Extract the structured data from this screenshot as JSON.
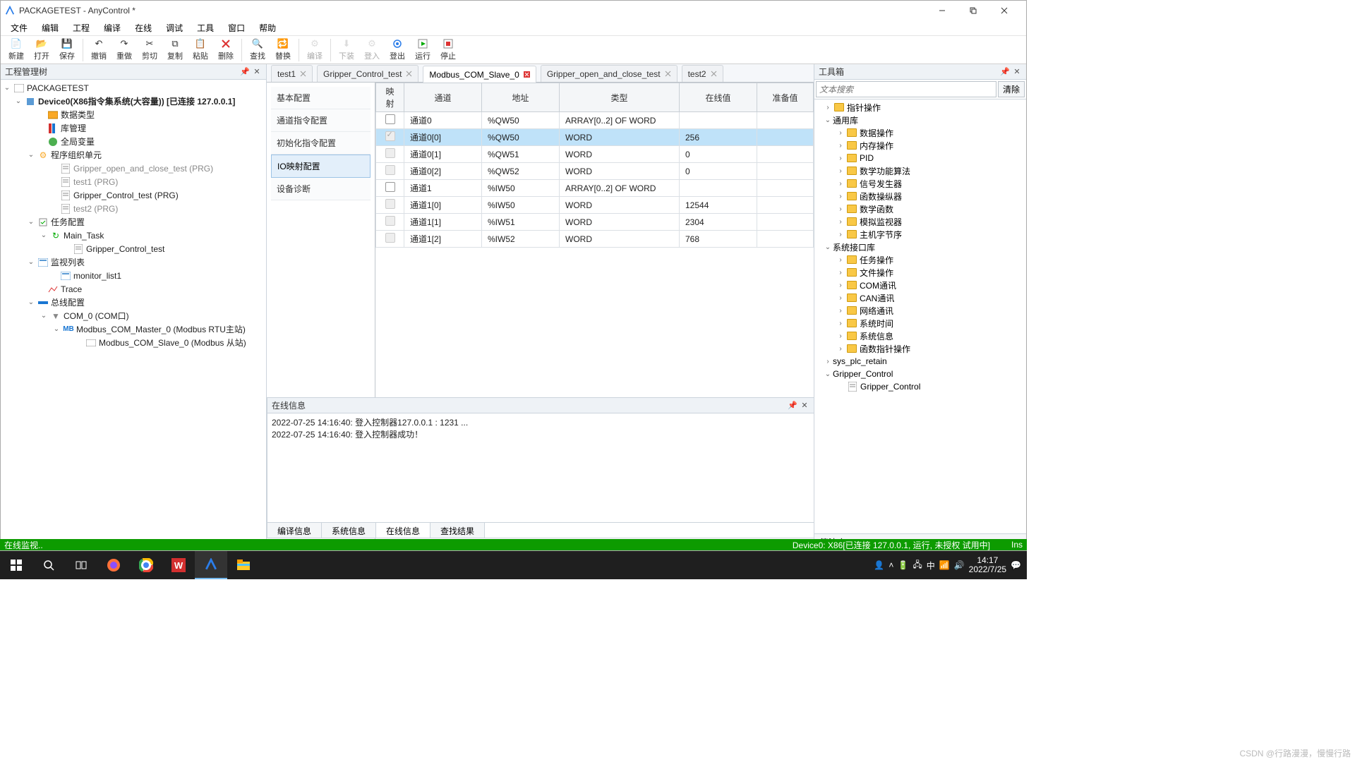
{
  "window": {
    "title": "PACKAGETEST - AnyControl *"
  },
  "menubar": [
    "文件",
    "编辑",
    "工程",
    "编译",
    "在线",
    "调试",
    "工具",
    "窗口",
    "帮助"
  ],
  "toolbar": [
    {
      "label": "新建",
      "icon": "new"
    },
    {
      "label": "打开",
      "icon": "open"
    },
    {
      "label": "保存",
      "icon": "save"
    },
    {
      "sep": true
    },
    {
      "label": "撤销",
      "icon": "undo"
    },
    {
      "label": "重做",
      "icon": "redo"
    },
    {
      "label": "剪切",
      "icon": "cut"
    },
    {
      "label": "复制",
      "icon": "copy"
    },
    {
      "label": "粘贴",
      "icon": "paste"
    },
    {
      "label": "删除",
      "icon": "delete"
    },
    {
      "sep": true
    },
    {
      "label": "查找",
      "icon": "find"
    },
    {
      "label": "替换",
      "icon": "replace"
    },
    {
      "sep": true
    },
    {
      "label": "编译",
      "icon": "compile",
      "dim": true
    },
    {
      "sep": true
    },
    {
      "label": "下装",
      "icon": "download",
      "dim": true
    },
    {
      "label": "登入",
      "icon": "login",
      "dim": true
    },
    {
      "label": "登出",
      "icon": "logout"
    },
    {
      "label": "运行",
      "icon": "run"
    },
    {
      "label": "停止",
      "icon": "stop"
    }
  ],
  "panel_titles": {
    "tree": "工程管理树",
    "toolbox": "工具箱",
    "online": "在线信息"
  },
  "tree": {
    "root": "PACKAGETEST",
    "device": "Device0(X86指令集系统(大容量)) [已连接 127.0.0.1]",
    "data_types": "数据类型",
    "lib": "库管理",
    "global": "全局变量",
    "pou": "程序组织单元",
    "pou_items": [
      "Gripper_open_and_close_test (PRG)",
      "test1 (PRG)",
      "Gripper_Control_test (PRG)",
      "test2 (PRG)"
    ],
    "task_cfg": "任务配置",
    "main_task": "Main_Task",
    "task_item": "Gripper_Control_test",
    "watch": "监视列表",
    "watch_item": "monitor_list1",
    "trace": "Trace",
    "bus": "总线配置",
    "com": "COM_0 (COM口)",
    "modbus_master": "Modbus_COM_Master_0 (Modbus RTU主站)",
    "modbus_slave": "Modbus_COM_Slave_0 (Modbus 从站)"
  },
  "tabs": [
    {
      "label": "test1",
      "close": "gray"
    },
    {
      "label": "Gripper_Control_test",
      "close": "gray"
    },
    {
      "label": "Modbus_COM_Slave_0",
      "close": "red",
      "active": true
    },
    {
      "label": "Gripper_open_and_close_test",
      "close": "gray"
    },
    {
      "label": "test2",
      "close": "gray"
    }
  ],
  "sidenav": [
    "基本配置",
    "通道指令配置",
    "初始化指令配置",
    "IO映射配置",
    "设备诊断"
  ],
  "sidenav_active": 3,
  "table": {
    "headers": [
      "映射",
      "通道",
      "地址",
      "类型",
      "在线值",
      "准备值"
    ],
    "rows": [
      {
        "chk": false,
        "dis": false,
        "ch": "通道0",
        "addr": "%QW50",
        "type": "ARRAY[0..2] OF WORD",
        "val": "",
        "prep": ""
      },
      {
        "chk": true,
        "dis": true,
        "ch": "通道0[0]",
        "addr": "%QW50",
        "type": "WORD",
        "val": "256",
        "prep": "",
        "sel": true
      },
      {
        "chk": false,
        "dis": true,
        "ch": "通道0[1]",
        "addr": "%QW51",
        "type": "WORD",
        "val": "0",
        "prep": ""
      },
      {
        "chk": false,
        "dis": true,
        "ch": "通道0[2]",
        "addr": "%QW52",
        "type": "WORD",
        "val": "0",
        "prep": ""
      },
      {
        "chk": false,
        "dis": false,
        "ch": "通道1",
        "addr": "%IW50",
        "type": "ARRAY[0..2] OF WORD",
        "val": "",
        "prep": ""
      },
      {
        "chk": false,
        "dis": true,
        "ch": "通道1[0]",
        "addr": "%IW50",
        "type": "WORD",
        "val": "12544",
        "prep": ""
      },
      {
        "chk": false,
        "dis": true,
        "ch": "通道1[1]",
        "addr": "%IW51",
        "type": "WORD",
        "val": "2304",
        "prep": ""
      },
      {
        "chk": false,
        "dis": true,
        "ch": "通道1[2]",
        "addr": "%IW52",
        "type": "WORD",
        "val": "768",
        "prep": ""
      }
    ]
  },
  "toolbox": {
    "search_placeholder": "文本搜索",
    "clear": "清除",
    "nodes": [
      {
        "pad": 8,
        "tw": "›",
        "label": "指针操作",
        "f": true
      },
      {
        "pad": 8,
        "tw": "⌄",
        "label": "通用库"
      },
      {
        "pad": 26,
        "tw": "›",
        "label": "数据操作",
        "f": true
      },
      {
        "pad": 26,
        "tw": "›",
        "label": "内存操作",
        "f": true
      },
      {
        "pad": 26,
        "tw": "›",
        "label": "PID",
        "f": true
      },
      {
        "pad": 26,
        "tw": "›",
        "label": "数学功能算法",
        "f": true
      },
      {
        "pad": 26,
        "tw": "›",
        "label": "信号发生器",
        "f": true
      },
      {
        "pad": 26,
        "tw": "›",
        "label": "函数操纵器",
        "f": true
      },
      {
        "pad": 26,
        "tw": "›",
        "label": "数学函数",
        "f": true
      },
      {
        "pad": 26,
        "tw": "›",
        "label": "模拟监视器",
        "f": true
      },
      {
        "pad": 26,
        "tw": "›",
        "label": "主机字节序",
        "f": true
      },
      {
        "pad": 8,
        "tw": "⌄",
        "label": "系统接口库"
      },
      {
        "pad": 26,
        "tw": "›",
        "label": "任务操作",
        "f": true
      },
      {
        "pad": 26,
        "tw": "›",
        "label": "文件操作",
        "f": true
      },
      {
        "pad": 26,
        "tw": "›",
        "label": "COM通讯",
        "f": true
      },
      {
        "pad": 26,
        "tw": "›",
        "label": "CAN通讯",
        "f": true
      },
      {
        "pad": 26,
        "tw": "›",
        "label": "网络通讯",
        "f": true
      },
      {
        "pad": 26,
        "tw": "›",
        "label": "系统时间",
        "f": true
      },
      {
        "pad": 26,
        "tw": "›",
        "label": "系统信息",
        "f": true
      },
      {
        "pad": 26,
        "tw": "›",
        "label": "函数指针操作",
        "f": true
      },
      {
        "pad": 8,
        "tw": "›",
        "label": "sys_plc_retain"
      },
      {
        "pad": 8,
        "tw": "⌄",
        "label": "Gripper_Control"
      },
      {
        "pad": 26,
        "tw": "",
        "label": "Gripper_Control",
        "doc": true
      }
    ],
    "alg": "算法库"
  },
  "log": {
    "lines": [
      "2022-07-25 14:16:40:  登入控制器127.0.0.1 : 1231 ...",
      "2022-07-25 14:16:40:  登入控制器成功！"
    ],
    "tabs": [
      "编译信息",
      "系统信息",
      "在线信息",
      "查找结果"
    ],
    "active": 2
  },
  "status": {
    "left": "在线监视..",
    "right": "Device0: X86[已连接 127.0.0.1, 运行, 未授权 试用中]",
    "ins": "Ins"
  },
  "taskbar": {
    "time": "14:17",
    "date": "2022/7/25"
  },
  "watermark": "CSDN @行路漫漫，慢慢行路"
}
